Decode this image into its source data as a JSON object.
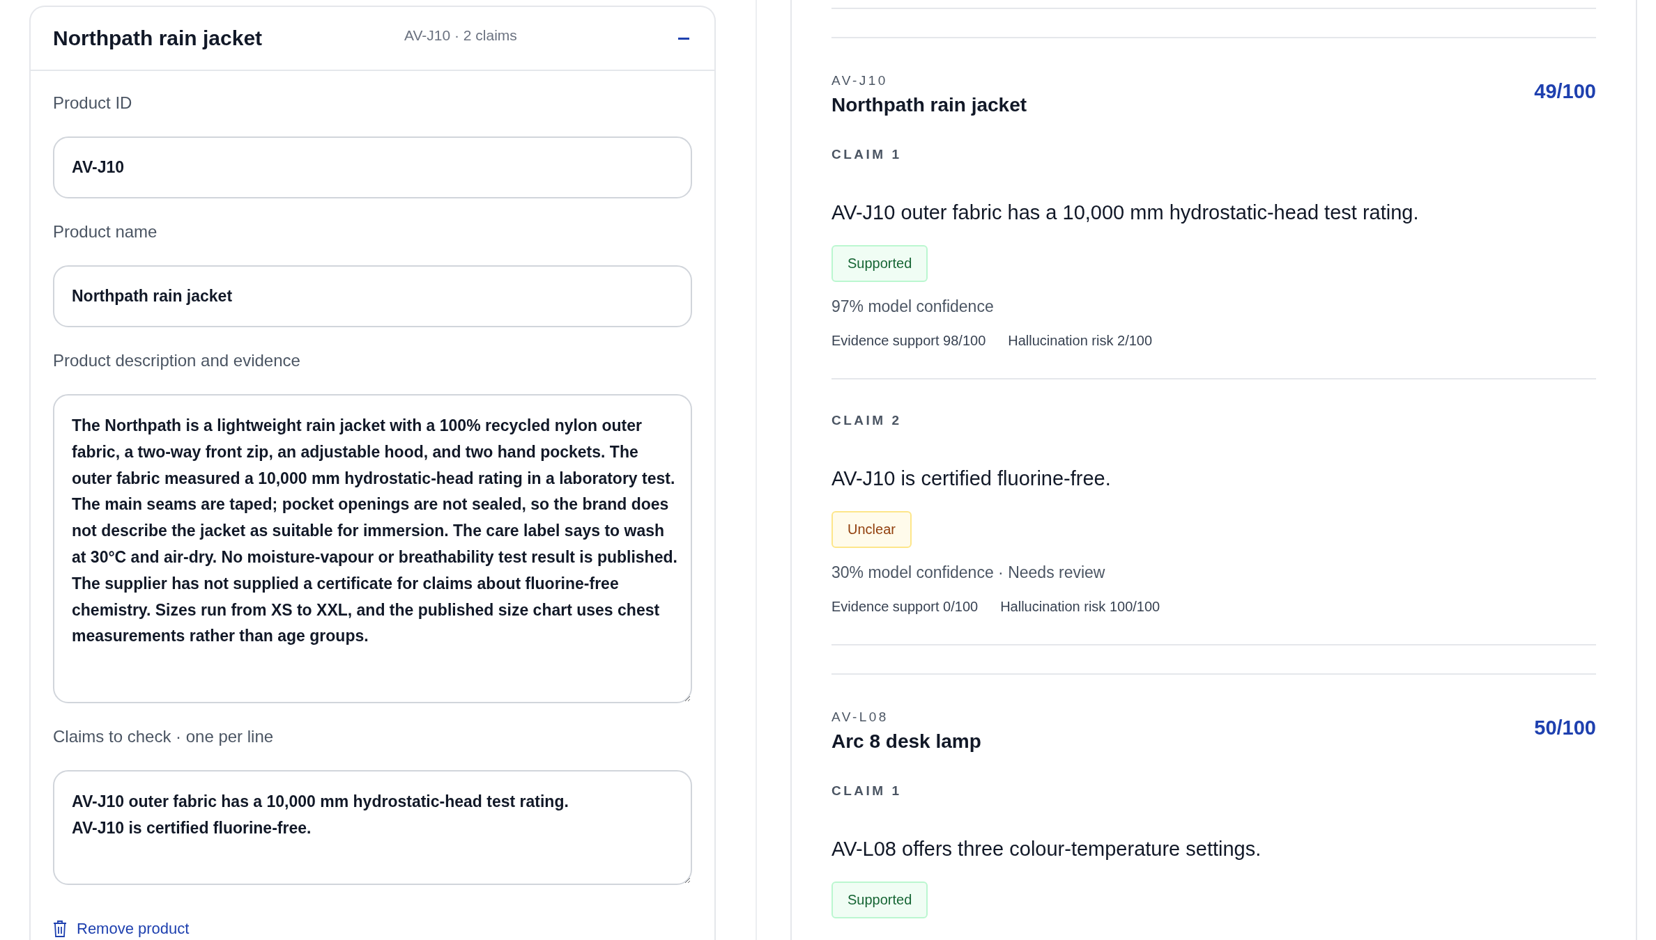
{
  "editor": {
    "title": "Northpath rain jacket",
    "summary": "AV-J10 · 2 claims",
    "expanded": true,
    "fields": [
      {
        "label": "Product ID",
        "value": "AV-J10",
        "kind": "input"
      },
      {
        "label": "Product name",
        "value": "Northpath rain jacket",
        "kind": "input"
      },
      {
        "label": "Product description and evidence",
        "value": "The Northpath is a lightweight rain jacket with a 100% recycled nylon outer fabric, a two-way front zip, an adjustable hood, and two hand pockets. The outer fabric measured a 10,000 mm hydrostatic-head rating in a laboratory test. The main seams are taped; pocket openings are not sealed, so the brand does not describe the jacket as suitable for immersion. The care label says to wash at 30°C and air-dry. No moisture-vapour or breathability test result is published. The supplier has not supplied a certificate for claims about fluorine-free chemistry. Sizes run from XS to XXL, and the published size chart uses chest measurements rather than age groups.",
        "kind": "textarea"
      },
      {
        "label": "Claims to check · one per line",
        "value": "AV-J10 outer fabric has a 10,000 mm hydrostatic-head test rating.\nAV-J10 is certified fluorine-free.",
        "kind": "textarea"
      }
    ],
    "remove_label": "Remove product"
  },
  "results": [
    {
      "id": "AV-J10",
      "name": "Northpath rain jacket",
      "score": "49/100",
      "claims": [
        {
          "label": "CLAIM 1",
          "text": "AV-J10 outer fabric has a 10,000 mm hydrostatic-head test rating.",
          "verdict": "Supported",
          "kind": "supported",
          "confidence": "97% model confidence",
          "evidence": "Evidence support 98/100",
          "risk": "Hallucination risk 2/100"
        },
        {
          "label": "CLAIM 2",
          "text": "AV-J10 is certified fluorine-free.",
          "verdict": "Unclear",
          "kind": "unclear",
          "confidence": "30% model confidence · Needs review",
          "evidence": "Evidence support 0/100",
          "risk": "Hallucination risk 100/100"
        }
      ]
    },
    {
      "id": "AV-L08",
      "name": "Arc 8 desk lamp",
      "score": "50/100",
      "claims": [
        {
          "label": "CLAIM 1",
          "text": "AV-L08 offers three colour-temperature settings.",
          "verdict": "Supported",
          "kind": "supported"
        }
      ]
    }
  ]
}
